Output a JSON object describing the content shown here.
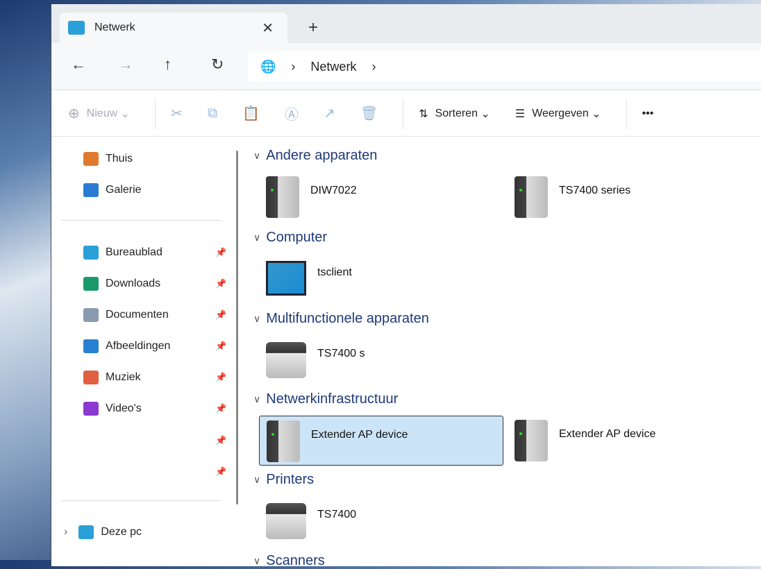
{
  "tab": {
    "title": "Netwerk",
    "close": "✕",
    "new": "+"
  },
  "nav": {
    "back": "←",
    "forward": "→",
    "up": "↑",
    "refresh": "↻",
    "breadcrumb": [
      "Netwerk"
    ],
    "sep": "›"
  },
  "toolbar": {
    "new": "Nieuw",
    "sort": "Sorteren",
    "view": "Weergeven",
    "more": "•••"
  },
  "sidebar": {
    "top": [
      {
        "label": "Thuis",
        "color": "#e07a30"
      },
      {
        "label": "Galerie",
        "color": "#2a7bd4"
      }
    ],
    "pinned": [
      {
        "label": "Bureaublad",
        "color": "#2a9fd8"
      },
      {
        "label": "Downloads",
        "color": "#1a9a6a"
      },
      {
        "label": "Documenten",
        "color": "#8a9bb0"
      },
      {
        "label": "Afbeeldingen",
        "color": "#2a80d0"
      },
      {
        "label": "Muziek",
        "color": "#e06040"
      },
      {
        "label": "Video's",
        "color": "#8a3ad0"
      }
    ],
    "this_pc": "Deze pc"
  },
  "groups": [
    {
      "title": "Andere apparaten",
      "items": [
        "DIW7022",
        "TS7400 series"
      ]
    },
    {
      "title": "Computer",
      "items": [
        "tsclient"
      ]
    },
    {
      "title": "Multifunctionele apparaten",
      "items": [
        "TS7400 s"
      ]
    },
    {
      "title": "Netwerkinfrastructuur",
      "items": [
        "Extender AP device",
        "Extender AP device"
      ]
    },
    {
      "title": "Printers",
      "items": [
        "TS7400"
      ]
    },
    {
      "title": "Scanners",
      "items": []
    }
  ]
}
